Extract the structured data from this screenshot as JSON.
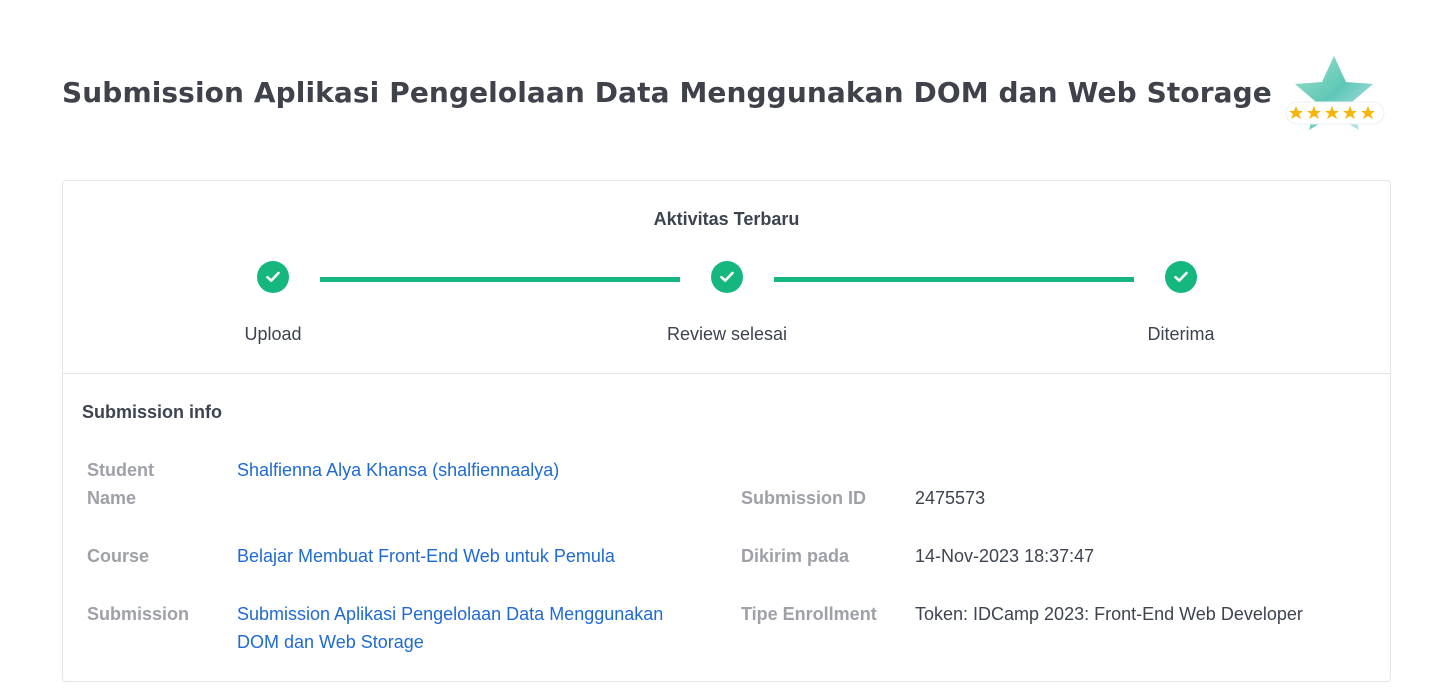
{
  "page": {
    "title": "Submission Aplikasi Pengelolaan Data Menggunakan DOM dan Web Storage"
  },
  "badge": {
    "icon": "five-star-rating-badge-icon",
    "stars": 5,
    "colors": {
      "star_body": "#7fd8c8",
      "stars": "#f5b50a"
    }
  },
  "activity": {
    "title": "Aktivitas Terbaru",
    "steps": [
      {
        "label": "Upload",
        "status": "done",
        "icon": "check-circle-icon"
      },
      {
        "label": "Review selesai",
        "status": "done",
        "icon": "check-circle-icon"
      },
      {
        "label": "Diterima",
        "status": "done",
        "icon": "check-circle-icon"
      }
    ],
    "accent_color": "#16b77e"
  },
  "submission_info": {
    "title": "Submission info",
    "student_name": {
      "label_line1": "Student",
      "label_line2": "Name",
      "value": "Shalfienna Alya Khansa (shalfiennaalya)"
    },
    "course": {
      "label": "Course",
      "value": "Belajar Membuat Front-End Web untuk Pemula"
    },
    "submission": {
      "label": "Submission",
      "value_line1": "Submission Aplikasi Pengelolaan Data Menggunakan",
      "value_line2": "DOM dan Web Storage"
    },
    "submission_id": {
      "label": "Submission ID",
      "value": "2475573"
    },
    "sent_at": {
      "label": "Dikirim pada",
      "value": "14-Nov-2023 18:37:47"
    },
    "enrollment_type": {
      "label": "Tipe Enrollment",
      "value": "Token: IDCamp 2023: Front-End Web Developer"
    },
    "link_color": "#1f6ad4"
  }
}
